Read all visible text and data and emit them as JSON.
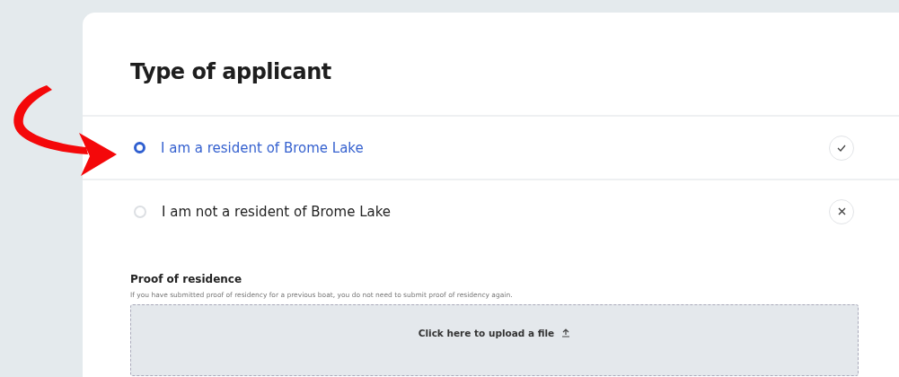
{
  "title": "Type of applicant",
  "options": [
    {
      "label": "I am a resident of Brome Lake",
      "selected": true,
      "kind": "check"
    },
    {
      "label": "I am not a resident of Brome Lake",
      "selected": false,
      "kind": "cross"
    }
  ],
  "proof": {
    "label": "Proof of residence",
    "hint": "If you have submitted proof of residency for a previous boat, you do not need to submit proof of residency again.",
    "upload": "Click here to upload a file"
  }
}
